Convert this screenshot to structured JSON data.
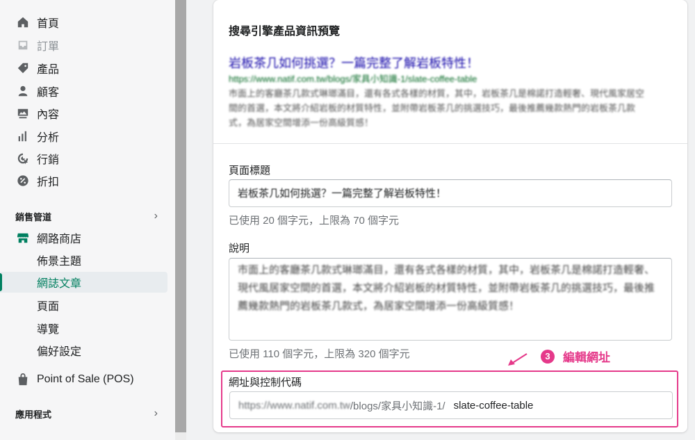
{
  "sidebar": {
    "nav": [
      {
        "label": "首頁",
        "icon": "home-icon"
      },
      {
        "label": "訂單",
        "icon": "inbox-icon",
        "disabled": true
      },
      {
        "label": "產品",
        "icon": "tag-icon"
      },
      {
        "label": "顧客",
        "icon": "person-icon"
      },
      {
        "label": "內容",
        "icon": "image-icon"
      },
      {
        "label": "分析",
        "icon": "bar-chart-icon"
      },
      {
        "label": "行銷",
        "icon": "target-icon"
      },
      {
        "label": "折扣",
        "icon": "discount-icon"
      }
    ],
    "sales_channels_heading": "銷售管道",
    "online_store": "網路商店",
    "sub_items": [
      "佈景主題",
      "網誌文章",
      "頁面",
      "導覽",
      "偏好設定"
    ],
    "active_sub": "網誌文章",
    "pos_label": "Point of Sale (POS)",
    "apps_heading": "應用程式"
  },
  "seo": {
    "card_title": "搜尋引擎產品資訊預覽",
    "preview_title": "岩板茶几如何挑選？一篇完整了解岩板特性！",
    "preview_url": "https://www.natif.com.tw/blogs/家具小知識-1/slate-coffee-table",
    "preview_desc": "市面上的客廳茶几款式琳瑯滿目，還有各式各樣的材質，其中，岩板茶几是棉諾打造輕奢、現代風家居空間的首選，本文將介紹岩板的材質特性，並附帶岩板茶几的挑選技巧，最後推薦幾款熱門的岩板茶几款式，為居家空間增添一份高級質感！",
    "page_title_label": "頁面標題",
    "page_title_value": "岩板茶几如何挑選？一篇完整了解岩板特性！",
    "page_title_helper": "已使用 20 個字元，上限為 70 個字元",
    "description_label": "說明",
    "description_value": "市面上的客廳茶几款式琳瑯滿目，還有各式各樣的材質，其中，岩板茶几是棉諾打造輕奢、現代風居家空間的首選，本文將介紹岩板的材質特性，並附帶岩板茶几的挑選技巧，最後推薦幾款熱門的岩板茶几款式，為居家空間增添一份高級質感！",
    "description_helper": "已使用 110 個字元，上限為 320 個字元",
    "url_label": "網址與控制代碼",
    "url_prefix_blurred": "https://www.natif.com.tw",
    "url_prefix_visible": "/blogs/家具小知識-1/",
    "url_handle": "slate-coffee-table"
  },
  "annotation": {
    "number": "3",
    "text": "編輯網址",
    "color": "#e5398a"
  }
}
